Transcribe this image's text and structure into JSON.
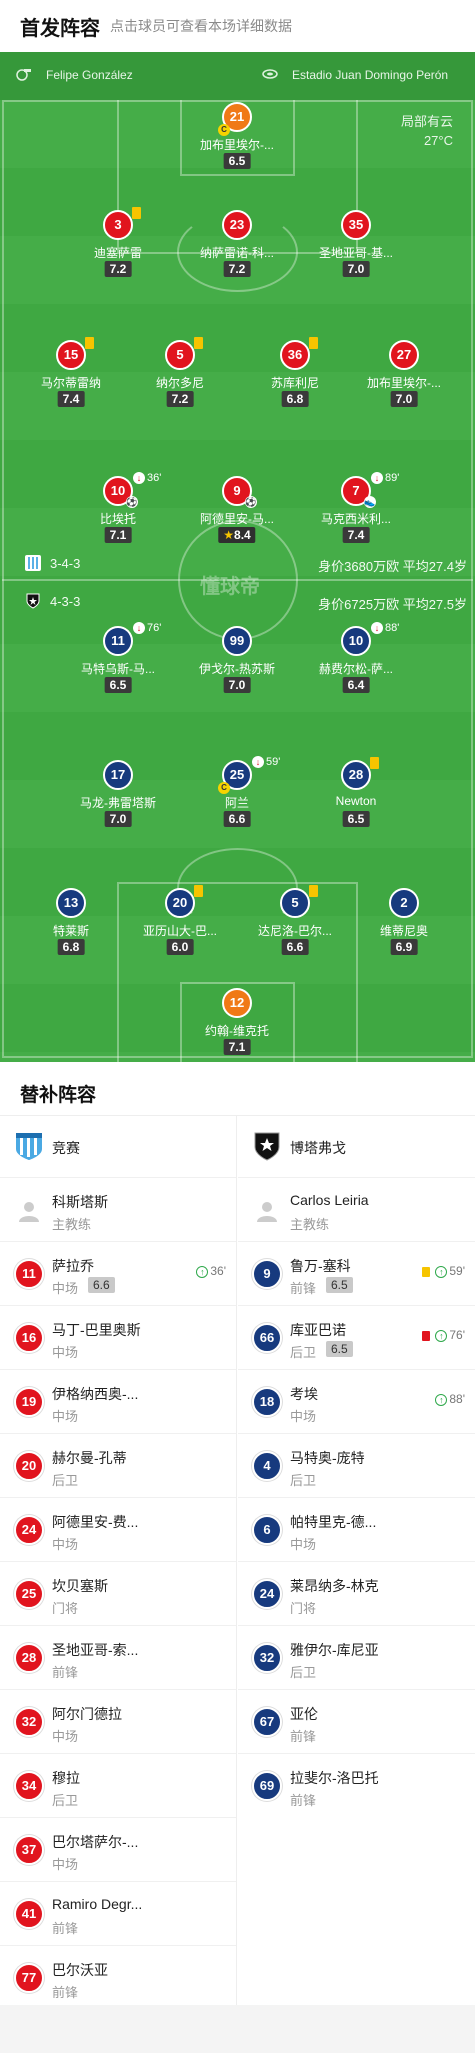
{
  "header": {
    "title": "首发阵容",
    "subtitle": "点击球员可查看本场详细数据"
  },
  "match_info": {
    "referee": "Felipe González",
    "stadium": "Estadio Juan Domingo Perón",
    "weather": "局部有云",
    "temperature": "27°C"
  },
  "watermark": "懂球帝",
  "formations": {
    "home": {
      "formation": "3-4-3",
      "value": "身价3680万欧 平均27.4岁"
    },
    "away": {
      "formation": "4-3-3",
      "value": "身价6725万欧 平均27.5岁"
    }
  },
  "home_starters": [
    {
      "num": "21",
      "name": "加布里埃尔-...",
      "rating": "6.5"
    },
    {
      "num": "3",
      "name": "迪塞萨雷",
      "rating": "7.2"
    },
    {
      "num": "23",
      "name": "纳萨雷诺-科...",
      "rating": "7.2"
    },
    {
      "num": "35",
      "name": "圣地亚哥-基...",
      "rating": "7.0"
    },
    {
      "num": "15",
      "name": "马尔蒂雷纳",
      "rating": "7.4"
    },
    {
      "num": "5",
      "name": "纳尔多尼",
      "rating": "7.2"
    },
    {
      "num": "36",
      "name": "苏库利尼",
      "rating": "6.8"
    },
    {
      "num": "27",
      "name": "加布里埃尔-...",
      "rating": "7.0"
    },
    {
      "num": "10",
      "name": "比埃托",
      "rating": "7.1",
      "event": "36'"
    },
    {
      "num": "9",
      "name": "阿德里安-马...",
      "rating": "8.4"
    },
    {
      "num": "7",
      "name": "马克西米利...",
      "rating": "7.4",
      "event": "89'"
    }
  ],
  "away_starters": [
    {
      "num": "11",
      "name": "马特乌斯-马...",
      "rating": "6.5",
      "event": "76'"
    },
    {
      "num": "99",
      "name": "伊戈尔-热苏斯",
      "rating": "7.0"
    },
    {
      "num": "10",
      "name": "赫费尔松-萨...",
      "rating": "6.4",
      "event": "88'"
    },
    {
      "num": "17",
      "name": "马龙-弗雷塔斯",
      "rating": "7.0"
    },
    {
      "num": "25",
      "name": "阿兰",
      "rating": "6.6",
      "event": "59'"
    },
    {
      "num": "28",
      "name": "Newton",
      "rating": "6.5"
    },
    {
      "num": "13",
      "name": "特莱斯",
      "rating": "6.8"
    },
    {
      "num": "20",
      "name": "亚历山大-巴...",
      "rating": "6.0"
    },
    {
      "num": "5",
      "name": "达尼洛-巴尔...",
      "rating": "6.6"
    },
    {
      "num": "2",
      "name": "维蒂尼奥",
      "rating": "6.9"
    },
    {
      "num": "12",
      "name": "约翰-维克托",
      "rating": "7.1"
    }
  ],
  "subs": {
    "title": "替补阵容",
    "home": {
      "team": "竞赛",
      "coach": {
        "name": "科斯塔斯",
        "role": "主教练"
      },
      "players": [
        {
          "num": "11",
          "name": "萨拉乔",
          "pos": "中场",
          "rating": "6.6",
          "event": "36'"
        },
        {
          "num": "16",
          "name": "马丁-巴里奥斯",
          "pos": "中场"
        },
        {
          "num": "19",
          "name": "伊格纳西奥-...",
          "pos": "中场"
        },
        {
          "num": "20",
          "name": "赫尔曼-孔蒂",
          "pos": "后卫"
        },
        {
          "num": "24",
          "name": "阿德里安-费...",
          "pos": "中场"
        },
        {
          "num": "25",
          "name": "坎贝塞斯",
          "pos": "门将"
        },
        {
          "num": "28",
          "name": "圣地亚哥-索...",
          "pos": "前锋"
        },
        {
          "num": "32",
          "name": "阿尔门德拉",
          "pos": "中场"
        },
        {
          "num": "34",
          "name": "穆拉",
          "pos": "后卫"
        },
        {
          "num": "37",
          "name": "巴尔塔萨尔-...",
          "pos": "中场"
        },
        {
          "num": "41",
          "name": "Ramiro Degr...",
          "pos": "前锋"
        },
        {
          "num": "77",
          "name": "巴尔沃亚",
          "pos": "前锋"
        }
      ]
    },
    "away": {
      "team": "博塔弗戈",
      "coach": {
        "name": "Carlos Leiria",
        "role": "主教练"
      },
      "players": [
        {
          "num": "9",
          "name": "鲁万-塞科",
          "pos": "前锋",
          "rating": "6.5",
          "event": "59'"
        },
        {
          "num": "66",
          "name": "库亚巴诺",
          "pos": "后卫",
          "rating": "6.5",
          "event": "76'"
        },
        {
          "num": "18",
          "name": "考埃",
          "pos": "中场",
          "event": "88'"
        },
        {
          "num": "4",
          "name": "马特奥-庞特",
          "pos": "后卫"
        },
        {
          "num": "6",
          "name": "帕特里克-德...",
          "pos": "中场"
        },
        {
          "num": "24",
          "name": "莱昂纳多-林克",
          "pos": "门将"
        },
        {
          "num": "32",
          "name": "雅伊尔-库尼亚",
          "pos": "后卫"
        },
        {
          "num": "67",
          "name": "亚伦",
          "pos": "前锋"
        },
        {
          "num": "69",
          "name": "拉斐尔-洛巴托",
          "pos": "前锋"
        }
      ]
    }
  },
  "colors": {
    "pitch": "#3fa842",
    "home": "#e1141e",
    "away": "#173a7e",
    "keeper": "#f07916",
    "yellow_card": "#f6c400"
  }
}
